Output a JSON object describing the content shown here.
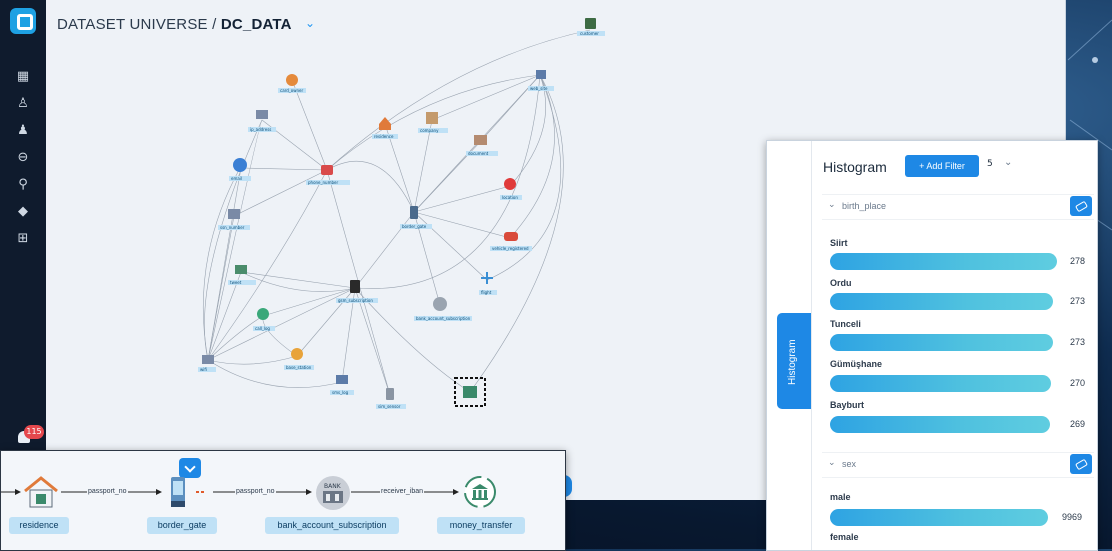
{
  "app": {
    "title_prefix": "DATASET UNIVERSE / ",
    "title_dataset": "DC_DATA",
    "notification_count": "115"
  },
  "sidebar": {
    "icons": [
      "dashboard-icon",
      "hierarchy-icon",
      "user-icon",
      "zoom-search-icon",
      "search-icon",
      "tag-icon",
      "network-icon"
    ]
  },
  "graph": {
    "nodes": [
      {
        "label": "customer",
        "icon": "building-icon"
      },
      {
        "label": "card_owner",
        "icon": "shop-icon"
      },
      {
        "label": "web_site",
        "icon": "network-icon"
      },
      {
        "label": "phone_number",
        "icon": "phone-icon"
      },
      {
        "label": "email",
        "icon": "mail-icon"
      },
      {
        "label": "ip_address",
        "icon": "network-icon"
      },
      {
        "label": "ssn_number",
        "icon": "pair-icon"
      },
      {
        "label": "tweet",
        "icon": "network-icon"
      },
      {
        "label": "residence",
        "icon": "home-icon"
      },
      {
        "label": "company",
        "icon": "company-icon"
      },
      {
        "label": "document",
        "icon": "document-icon"
      },
      {
        "label": "location",
        "icon": "pin-icon"
      },
      {
        "label": "vehicle_registered",
        "icon": "car-icon"
      },
      {
        "label": "flight",
        "icon": "plane-icon"
      },
      {
        "label": "border_gate",
        "icon": "device-icon"
      },
      {
        "label": "gsm_subscription",
        "icon": "sim-icon"
      },
      {
        "label": "bank_account_subscription",
        "icon": "bank-icon"
      },
      {
        "label": "call_log",
        "icon": "call-icon"
      },
      {
        "label": "base_station",
        "icon": "location-icon"
      },
      {
        "label": "sms_log",
        "icon": "network-icon"
      },
      {
        "label": "sim_sensor",
        "icon": "device-icon"
      },
      {
        "label": "money_transfer",
        "icon": "bank-icon"
      },
      {
        "label": "wifi",
        "icon": "network-icon"
      }
    ]
  },
  "histogram": {
    "tab_label": "Histogram",
    "title": "Histogram",
    "add_filter_label": "+ Add Filter",
    "limit_value": "5",
    "sections": [
      {
        "name": "birth_place",
        "items": [
          {
            "label": "Siirt",
            "value": 278
          },
          {
            "label": "Ordu",
            "value": 273
          },
          {
            "label": "Tunceli",
            "value": 273
          },
          {
            "label": "Gümüşhane",
            "value": 270
          },
          {
            "label": "Bayburt",
            "value": 269
          }
        ],
        "max": 278
      },
      {
        "name": "sex",
        "items": [
          {
            "label": "male",
            "value": 9969
          },
          {
            "label": "female",
            "value": null
          }
        ],
        "max": 9969
      }
    ]
  },
  "pipeline": {
    "nodes": [
      {
        "label": "residence",
        "icon": "home-icon"
      },
      {
        "label": "border_gate",
        "icon": "device-icon"
      },
      {
        "label": "bank_account_subscription",
        "icon": "bank-icon"
      },
      {
        "label": "money_transfer",
        "icon": "bank-icon"
      }
    ],
    "edges": [
      {
        "label": "passport_no"
      },
      {
        "label": "passport_no"
      },
      {
        "label": "receiver_iban"
      }
    ],
    "bank_text": "BANK"
  },
  "colors": {
    "accent": "#1e88e5",
    "sidebar": "#0f1b2d",
    "node_label_bg": "#bfe1f6",
    "bar_start": "#2ea3e3",
    "bar_end": "#5fcde0"
  }
}
